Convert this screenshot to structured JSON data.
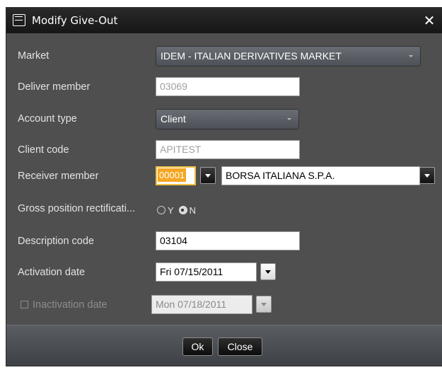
{
  "window": {
    "title": "Modify Give-Out",
    "close_glyph": "✕"
  },
  "form": {
    "market": {
      "label": "Market",
      "value": "IDEM - ITALIAN DERIVATIVES MARKET"
    },
    "deliver_member": {
      "label": "Deliver member",
      "value": "03069"
    },
    "account_type": {
      "label": "Account type",
      "value": "Client"
    },
    "client_code": {
      "label": "Client code",
      "value": "APITEST"
    },
    "receiver_member": {
      "label": "Receiver member",
      "code": "00001",
      "name": "BORSA ITALIANA S.P.A."
    },
    "gross_position": {
      "label": "Gross position rectificati...",
      "options": [
        {
          "label": "Y",
          "checked": false
        },
        {
          "label": "N",
          "checked": true
        }
      ]
    },
    "description_code": {
      "label": "Description code",
      "value": "03104"
    },
    "activation_date": {
      "label": "Activation date",
      "value": "Fri 07/15/2011"
    },
    "inactivation_date": {
      "label": "Inactivation date",
      "value": "Mon 07/18/2011",
      "checked": false
    }
  },
  "footer": {
    "ok_label": "Ok",
    "close_label": "Close"
  }
}
